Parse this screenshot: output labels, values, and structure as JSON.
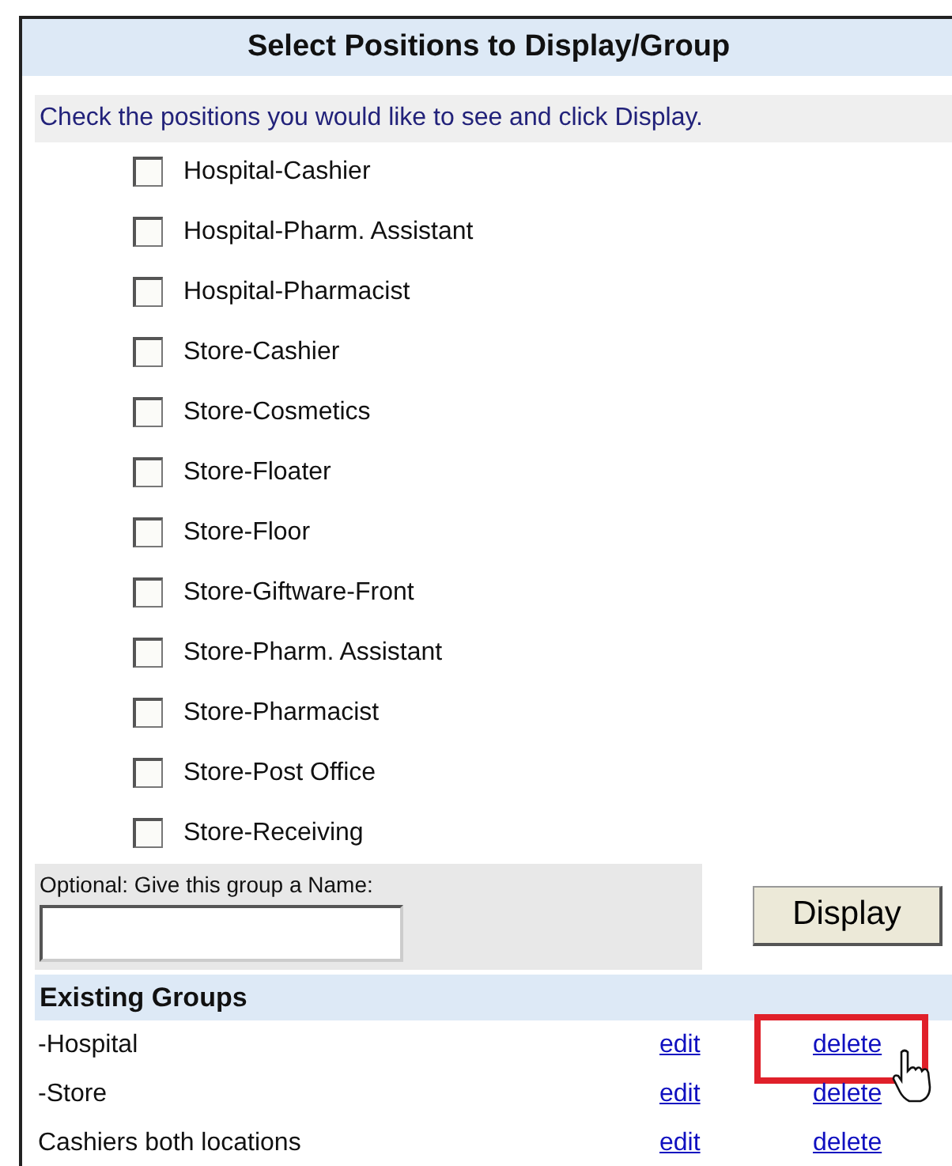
{
  "title": "Select Positions to Display/Group",
  "instruction": "Check the positions you would like to see and click Display.",
  "positions": [
    {
      "label": "Hospital-Cashier",
      "checked": false
    },
    {
      "label": "Hospital-Pharm. Assistant",
      "checked": false
    },
    {
      "label": "Hospital-Pharmacist",
      "checked": false
    },
    {
      "label": "Store-Cashier",
      "checked": false
    },
    {
      "label": "Store-Cosmetics",
      "checked": false
    },
    {
      "label": "Store-Floater",
      "checked": false
    },
    {
      "label": "Store-Floor",
      "checked": false
    },
    {
      "label": "Store-Giftware-Front",
      "checked": false
    },
    {
      "label": "Store-Pharm. Assistant",
      "checked": false
    },
    {
      "label": "Store-Pharmacist",
      "checked": false
    },
    {
      "label": "Store-Post Office",
      "checked": false
    },
    {
      "label": "Store-Receiving",
      "checked": false
    }
  ],
  "group_name": {
    "label": "Optional: Give this group a Name:"
  },
  "display_button": "Display",
  "existing_groups": {
    "heading": "Existing Groups",
    "rows": [
      {
        "name": "-Hospital",
        "edit": "edit",
        "delete": "delete",
        "highlighted": true
      },
      {
        "name": "-Store",
        "edit": "edit",
        "delete": "delete",
        "highlighted": false
      },
      {
        "name": "Cashiers both locations",
        "edit": "edit",
        "delete": "delete",
        "highlighted": false
      }
    ]
  }
}
